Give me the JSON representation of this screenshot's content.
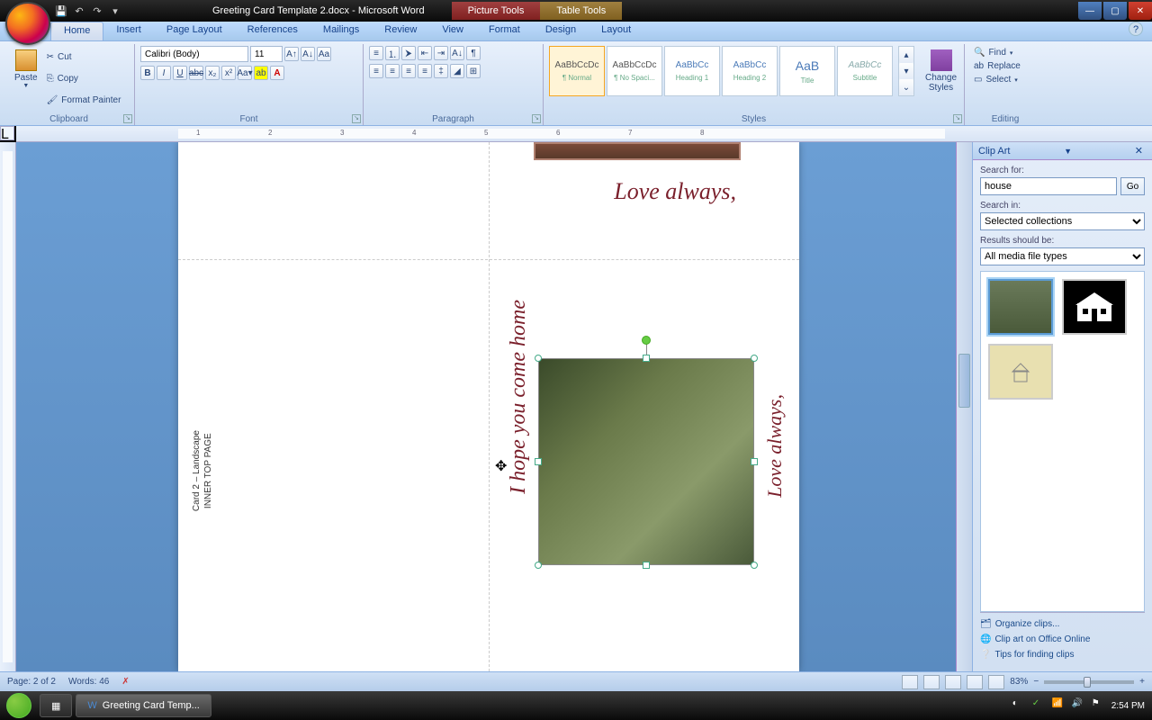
{
  "titlebar": {
    "doc_title": "Greeting Card Template 2.docx - Microsoft Word",
    "ctx_picture": "Picture Tools",
    "ctx_table": "Table Tools"
  },
  "tabs": {
    "home": "Home",
    "insert": "Insert",
    "page_layout": "Page Layout",
    "references": "References",
    "mailings": "Mailings",
    "review": "Review",
    "view": "View",
    "format": "Format",
    "design": "Design",
    "layout": "Layout"
  },
  "ribbon": {
    "paste": "Paste",
    "cut": "Cut",
    "copy": "Copy",
    "format_painter": "Format Painter",
    "clipboard": "Clipboard",
    "font_name": "Calibri (Body)",
    "font_size": "11",
    "font": "Font",
    "paragraph": "Paragraph",
    "styles": "Styles",
    "style_normal": "¶ Normal",
    "style_nospacing": "¶ No Spaci...",
    "style_h1": "Heading 1",
    "style_h2": "Heading 2",
    "style_title": "Title",
    "style_subtitle": "Subtitle",
    "style_preview": "AaBbCcDc",
    "style_preview_h": "AaBbCc",
    "style_preview_t": "AaB",
    "change_styles": "Change Styles",
    "editing": "Editing",
    "find": "Find",
    "replace": "Replace",
    "select": "Select"
  },
  "document": {
    "card_label_1": "Card 2 – Landscape",
    "card_label_2": "INNER TOP PAGE",
    "love_always": "Love always,",
    "hope_home": "I hope you come home",
    "love_always_2": "Love always,"
  },
  "clipart": {
    "title": "Clip Art",
    "search_for": "Search for:",
    "search_value": "house",
    "go": "Go",
    "search_in": "Search in:",
    "collections": "Selected collections",
    "results_should": "Results should be:",
    "media_types": "All media file types",
    "organize": "Organize clips...",
    "office_online": "Clip art on Office Online",
    "tips": "Tips for finding clips"
  },
  "statusbar": {
    "page": "Page: 2 of 2",
    "words": "Words: 46",
    "zoom": "83%"
  },
  "taskbar": {
    "word_task": "Greeting Card Temp...",
    "clock": "2:54 PM"
  }
}
